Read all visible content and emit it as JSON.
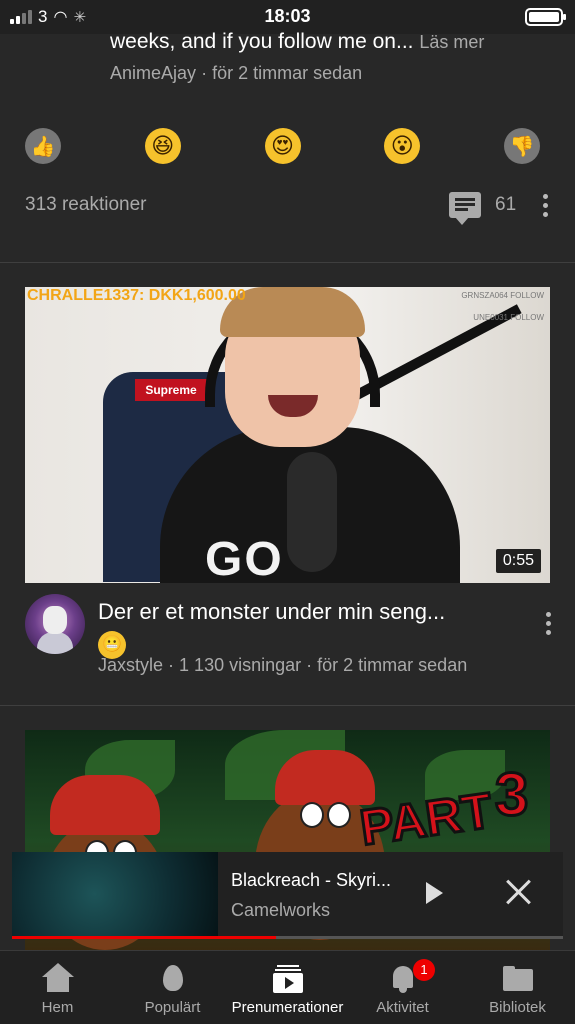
{
  "status_bar": {
    "carrier": "3",
    "time": "18:03"
  },
  "post": {
    "text": "weeks, and if you follow me on...",
    "more_label": "Läs mer",
    "channel": "AnimeAjay",
    "age": "för 2 timmar sedan",
    "reaction_count": "313 reaktioner",
    "comment_count": "61"
  },
  "video": {
    "title": "Der er et monster under min seng...",
    "title_emoji": "😬",
    "channel": "Jaxstyle",
    "views": "1 130 visningar",
    "age": "för 2 timmar sedan",
    "duration": "0:55",
    "thumb_banner": "CHRALLE1337: DKK1,600.00",
    "thumb_chair_text": "Supreme",
    "thumb_shirt_text": "GO",
    "thumb_follow_1": "UNE0031 FOLLOW",
    "thumb_follow_2": "GRNSZA064 FOLLOW"
  },
  "video2": {
    "thumb_part": "PART",
    "thumb_number": "3"
  },
  "mini_player": {
    "title": "Blackreach - Skyri...",
    "channel": "Camelworks",
    "progress": 0.48
  },
  "bottom_nav": {
    "items": [
      {
        "label": "Hem",
        "icon": "home-icon"
      },
      {
        "label": "Populärt",
        "icon": "fire-icon"
      },
      {
        "label": "Prenumerationer",
        "icon": "subscriptions-icon"
      },
      {
        "label": "Aktivitet",
        "icon": "bell-icon"
      },
      {
        "label": "Bibliotek",
        "icon": "folder-icon"
      }
    ],
    "active_index": 2,
    "activity_badge": "1"
  },
  "colors": {
    "background": "#282828",
    "accent": "#ee0000",
    "secondary_text": "#aaaaaa"
  }
}
